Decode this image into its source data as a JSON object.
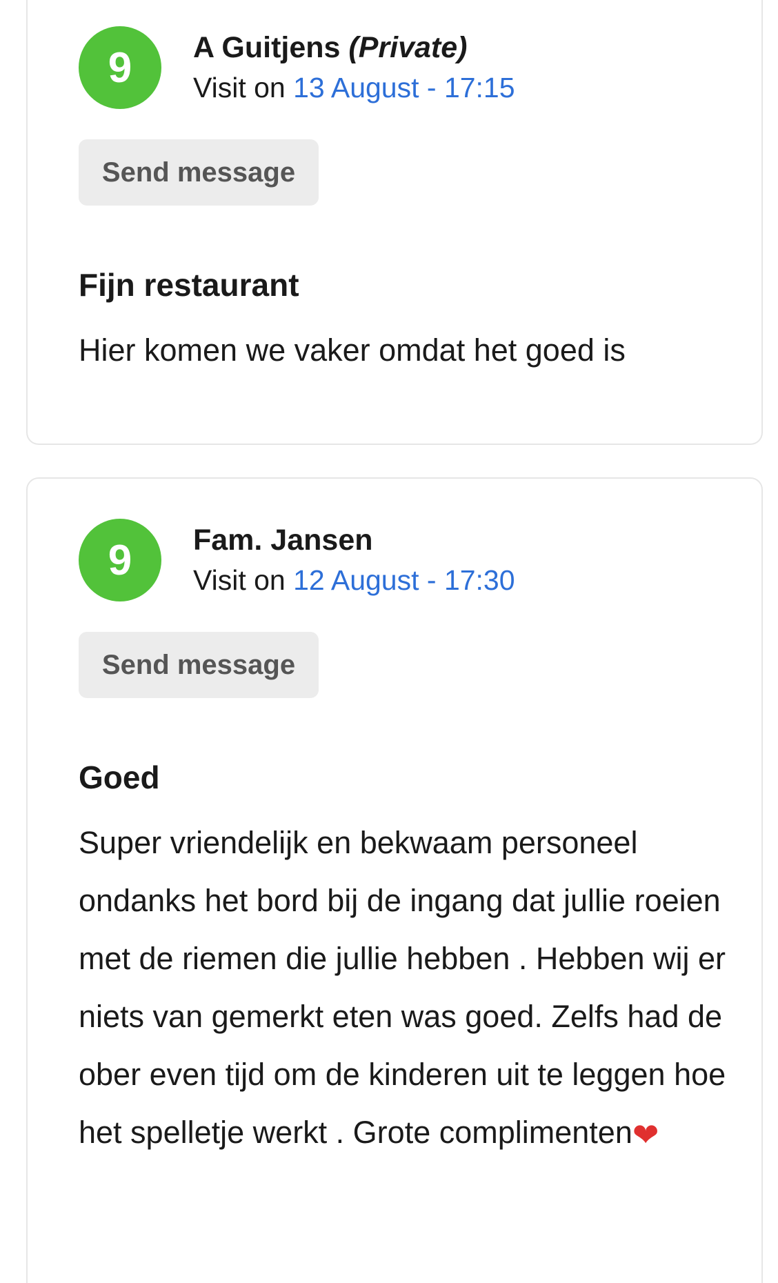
{
  "reviews": [
    {
      "score": "9",
      "reviewer_name": "A Guitjens",
      "reviewer_tag": "(Private)",
      "visit_prefix": "Visit on",
      "visit_date": "13 August - 17:15",
      "send_button_label": "Send message",
      "title": "Fijn restaurant",
      "body": "Hier komen we vaker omdat het goed is"
    },
    {
      "score": "9",
      "reviewer_name": "Fam. Jansen",
      "reviewer_tag": "",
      "visit_prefix": "Visit on",
      "visit_date": "12 August - 17:30",
      "send_button_label": "Send message",
      "title": "Goed",
      "body": "Super vriendelijk en bekwaam personeel ondanks het bord bij de ingang dat jullie roeien met de riemen die jullie hebben . Hebben wij er niets van gemerkt eten was goed. Zelfs had de ober even tijd om de kinderen uit te leggen hoe het spelletje werkt . Grote complimenten"
    }
  ],
  "icons": {
    "heart": "heart-icon"
  },
  "colors": {
    "score_badge": "#52c23a",
    "visit_date": "#2d6fd8",
    "button_bg": "#ececec",
    "heart": "#e0302f"
  }
}
